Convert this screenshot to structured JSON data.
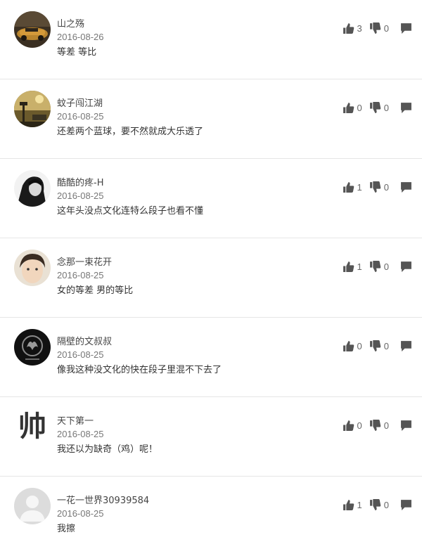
{
  "colors": {
    "icon": "#555555",
    "divider": "#e6e6e6"
  },
  "comments": [
    {
      "user": "山之殇",
      "date": "2016-08-26",
      "text": "等差 等比",
      "likes": "3",
      "dislikes": "0",
      "avatar": "car-photo"
    },
    {
      "user": "蚊子闯江湖",
      "date": "2016-08-25",
      "text": "还差两个蓝球，要不然就成大乐透了",
      "likes": "0",
      "dislikes": "0",
      "avatar": "lamp-photo"
    },
    {
      "user": "酷酷的疼-H",
      "date": "2016-08-25",
      "text": "这年头没点文化连特么段子也看不懂",
      "likes": "1",
      "dislikes": "0",
      "avatar": "bw-portrait"
    },
    {
      "user": "念那一束花开",
      "date": "2016-08-25",
      "text": "女的等差 男的等比",
      "likes": "1",
      "dislikes": "0",
      "avatar": "face-photo"
    },
    {
      "user": "隔壁的文叔叔",
      "date": "2016-08-25",
      "text": "像我这种没文化的快在段子里混不下去了",
      "likes": "0",
      "dislikes": "0",
      "avatar": "dragon-emblem"
    },
    {
      "user": "天下第一",
      "date": "2016-08-25",
      "text": "我还以为缺奇（鸡）呢！",
      "likes": "0",
      "dislikes": "0",
      "avatar": "shuai-character",
      "avatar_text": "帅"
    },
    {
      "user": "一花一世界30939584",
      "date": "2016-08-25",
      "text": "我擦",
      "likes": "1",
      "dislikes": "0",
      "avatar": "default-user"
    }
  ]
}
